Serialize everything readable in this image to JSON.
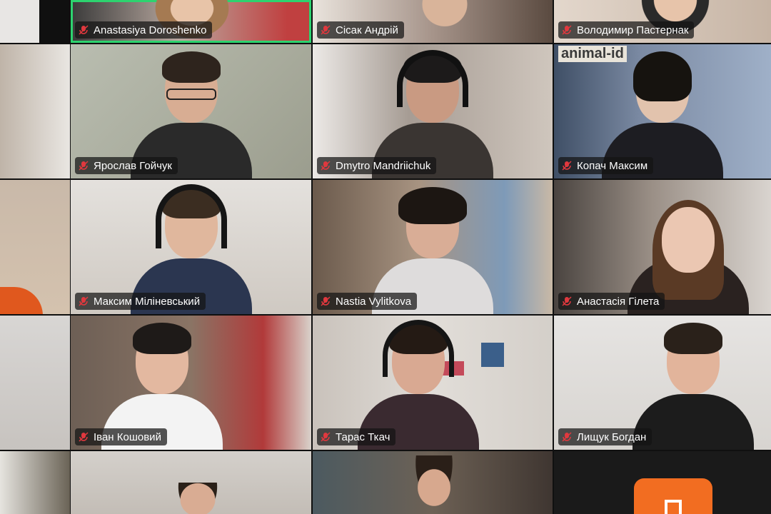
{
  "participants": [
    {
      "name": "Anastasiya Doroshenko",
      "active": true
    },
    {
      "name": "Сісак Андрій"
    },
    {
      "name": "Володимир Пастернак"
    },
    {
      "name": "Ярослав Гойчук"
    },
    {
      "name": "Dmytro Mandriichuk"
    },
    {
      "name": "Копач Максим"
    },
    {
      "name": "Максим Міліневський"
    },
    {
      "name": "Nastia Vylitkova"
    },
    {
      "name": "Анастасія Гілета"
    },
    {
      "name": "Іван Кошовий"
    },
    {
      "name": "Тарас Ткач"
    },
    {
      "name": "Лищук Богдан"
    }
  ],
  "poster_text": "animal-id",
  "colors": {
    "active_border": "#2dd36f",
    "muted_mic": "#e0383e",
    "share_button": "#f26d21",
    "nametag_bg": "#141414"
  }
}
